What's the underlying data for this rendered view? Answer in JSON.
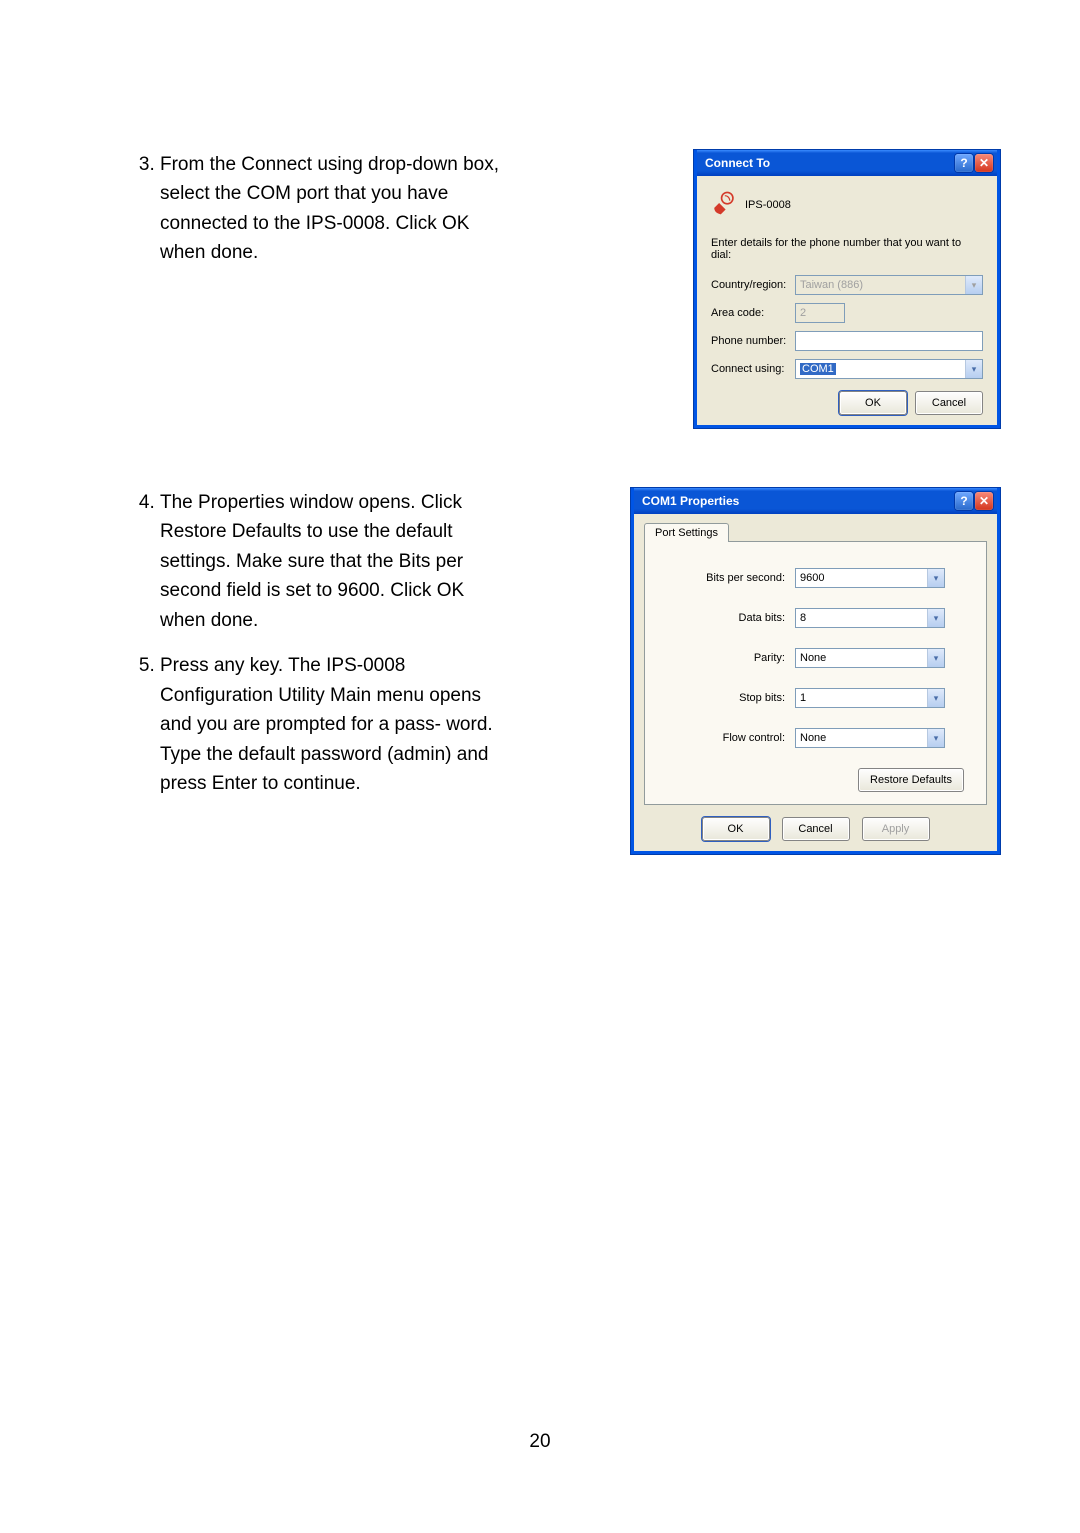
{
  "steps": {
    "s3": {
      "num": "3.",
      "text": "From the Connect using drop-down box, select the COM port that you have connected to the IPS-0008. Click OK when done."
    },
    "s4": {
      "num": "4.",
      "text": "The Properties window opens. Click Restore Defaults to use the default settings. Make sure that the Bits per second field is set to 9600. Click OK when done."
    },
    "s5": {
      "num": "5.",
      "text": "Press any key. The IPS-0008 Configuration Utility Main menu opens and you are prompted for a pass- word. Type the default password (admin) and press Enter to continue."
    }
  },
  "connect": {
    "title": "Connect To",
    "name": "IPS-0008",
    "instruction": "Enter details for the phone number that you want to dial:",
    "country_label": "Country/region:",
    "country_value": "Taiwan (886)",
    "area_label": "Area code:",
    "area_value": "2",
    "phone_label": "Phone number:",
    "phone_value": "",
    "using_label": "Connect using:",
    "using_value": "COM1",
    "ok": "OK",
    "cancel": "Cancel"
  },
  "com": {
    "title": "COM1 Properties",
    "tab": "Port Settings",
    "bps_label": "Bits per second:",
    "bps_value": "9600",
    "databits_label": "Data bits:",
    "databits_value": "8",
    "parity_label": "Parity:",
    "parity_value": "None",
    "stopbits_label": "Stop bits:",
    "stopbits_value": "1",
    "flow_label": "Flow control:",
    "flow_value": "None",
    "restore": "Restore Defaults",
    "ok": "OK",
    "cancel": "Cancel",
    "apply": "Apply"
  },
  "page_number": "20"
}
